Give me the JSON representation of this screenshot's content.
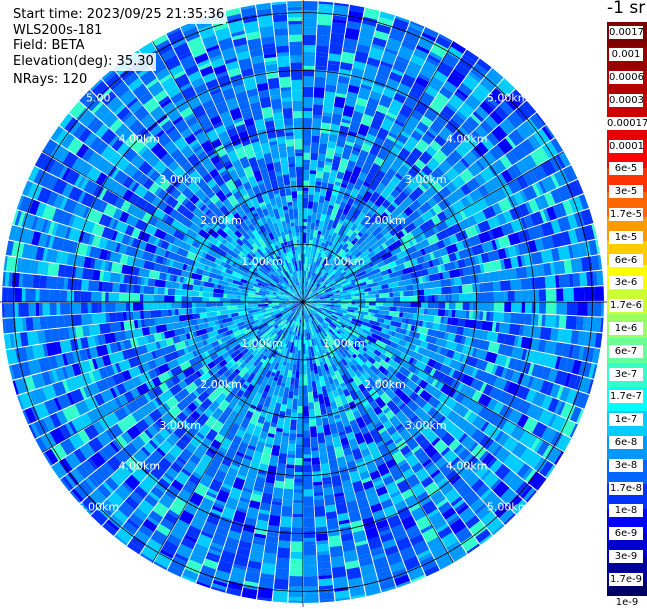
{
  "info": {
    "start_time": "Start time: 2023/09/25 21:35:36",
    "instrument": "WLS200s-181",
    "field": "Field: BETA",
    "elevation": "Elevation(deg): 35.30",
    "nrays": "NRays: 120"
  },
  "colorbar": {
    "units": "-1 sr",
    "colors": [
      "#7f0000",
      "#990000",
      "#b30000",
      "#cc0000",
      "#e60000",
      "#ff0000",
      "#ff3300",
      "#ff6600",
      "#ff9900",
      "#ffcc00",
      "#ffff00",
      "#ccff33",
      "#99ff66",
      "#66ff99",
      "#33ffcc",
      "#00ffff",
      "#00ccff",
      "#0099ff",
      "#0066ff",
      "#0033ff",
      "#0000ff",
      "#0000cc",
      "#000099",
      "#000066"
    ],
    "labels": [
      "0.0017",
      "0.001",
      "0.0006",
      "0.0003",
      "0.00017",
      "0.0001",
      "6e-5",
      "3e-5",
      "1.7e-5",
      "1e-5",
      "6e-6",
      "3e-6",
      "1.7e-6",
      "1e-6",
      "6e-7",
      "3e-7",
      "1.7e-7",
      "1e-7",
      "6e-8",
      "3e-8",
      "1.7e-8",
      "1e-8",
      "6e-9",
      "3e-9",
      "1.7e-9",
      "1e-9"
    ]
  },
  "chart_data": {
    "type": "heatmap",
    "subtype": "ppi-polar-scan",
    "field": "BETA",
    "elevation_deg": 35.3,
    "n_rays": 120,
    "max_range_km": 5.2,
    "range_rings_km": [
      1.0,
      2.0,
      3.0,
      4.0,
      5.0
    ],
    "ring_labels": [
      "1.00km",
      "2.00km",
      "3.00km",
      "4.00km",
      "5.00km"
    ],
    "ring_label_bearings_deg": [
      -45,
      45,
      135,
      225
    ],
    "spoke_bearings_deg": [
      0,
      30,
      60,
      90,
      120,
      150,
      180,
      210,
      240,
      270,
      300,
      330
    ],
    "value_scale": "log",
    "dominant_values": [
      "1e-8",
      "1.7e-8",
      "3e-8",
      "1e-7"
    ],
    "near_range_values": [
      "3e-8",
      "6e-8",
      "1e-7",
      "1.7e-7"
    ],
    "partial_ring_label": "5.00"
  }
}
